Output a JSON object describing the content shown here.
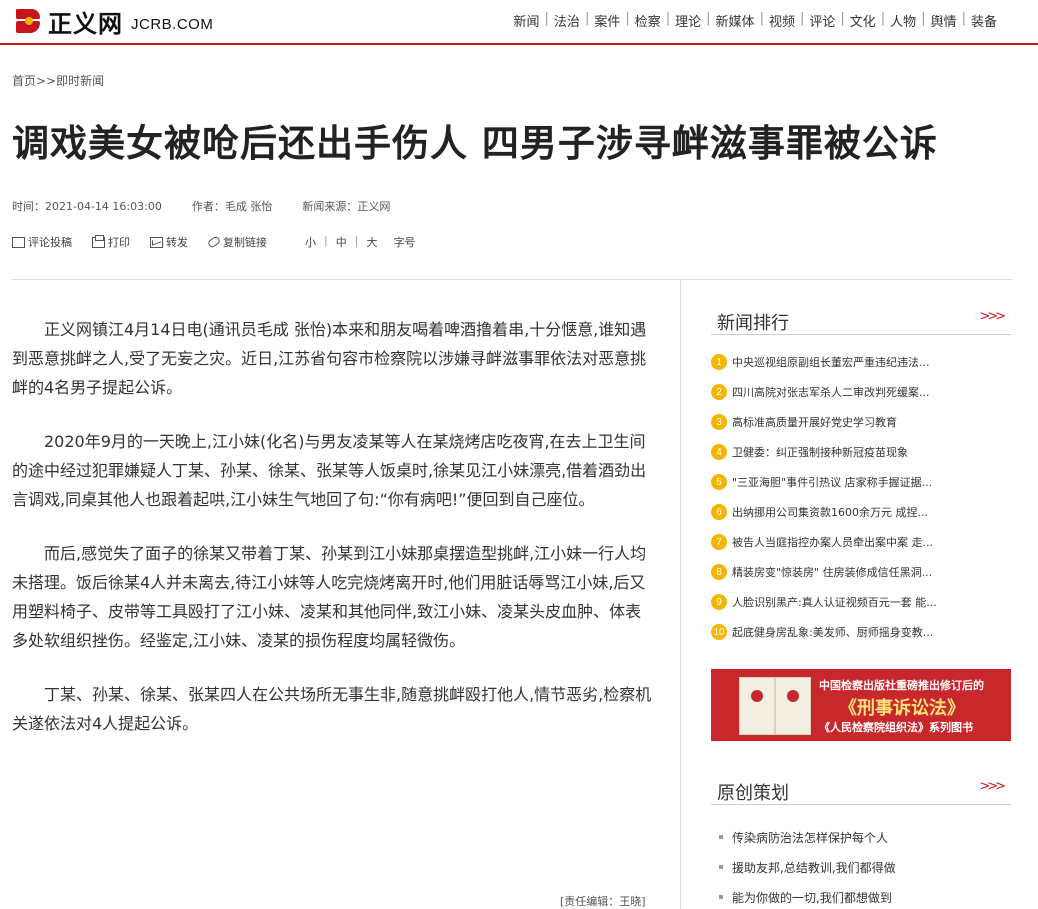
{
  "header": {
    "logo_text": "正义网",
    "logo_domain": "JCRB.COM",
    "nav": [
      "新闻",
      "法治",
      "案件",
      "检察",
      "理论",
      "新媒体",
      "视频",
      "评论",
      "文化",
      "人物",
      "舆情",
      "装备"
    ]
  },
  "breadcrumb": "首页>>即时新闻",
  "article": {
    "title": "调戏美女被呛后还出手伤人 四男子涉寻衅滋事罪被公诉",
    "time": "时间：2021-04-14 16:03:00",
    "author": "作者：毛成 张怡",
    "source": "新闻来源：正义网",
    "tools": {
      "comment": "评论投稿",
      "print": "打印",
      "forward": "转发",
      "copy_link": "复制链接",
      "size_small": "小",
      "size_medium": "中",
      "size_large": "大",
      "size_label": "字号"
    },
    "paragraphs": [
      "正义网镇江4月14日电(通讯员毛成 张怡)本来和朋友喝着啤酒撸着串,十分惬意,谁知遇到恶意挑衅之人,受了无妄之灾。近日,江苏省句容市检察院以涉嫌寻衅滋事罪依法对恶意挑衅的4名男子提起公诉。",
      "2020年9月的一天晚上,江小妹(化名)与男友凌某等人在某烧烤店吃夜宵,在去上卫生间的途中经过犯罪嫌疑人丁某、孙某、徐某、张某等人饭桌时,徐某见江小妹漂亮,借着酒劲出言调戏,同桌其他人也跟着起哄,江小妹生气地回了句:“你有病吧!”便回到自己座位。",
      "而后,感觉失了面子的徐某又带着丁某、孙某到江小妹那桌摆造型挑衅,江小妹一行人均未搭理。饭后徐某4人并未离去,待江小妹等人吃完烧烤离开时,他们用脏话辱骂江小妹,后又用塑料椅子、皮带等工具殴打了江小妹、凌某和其他同伴,致江小妹、凌某头皮血肿、体表多处软组织挫伤。经鉴定,江小妹、凌某的损伤程度均属轻微伤。",
      "丁某、孙某、徐某、张某四人在公共场所无事生非,随意挑衅殴打他人,情节恶劣,检察机关遂依法对4人提起公诉。"
    ],
    "editor": "[责任编辑：王晓]"
  },
  "sidebar": {
    "ranking_title": "新闻排行",
    "more": ">>>",
    "ranking": [
      {
        "num": "1",
        "text": "中央巡视组原副组长董宏严重违纪违法..."
      },
      {
        "num": "2",
        "text": "四川高院对张志军杀人二审改判死缓案..."
      },
      {
        "num": "3",
        "text": "高标准高质量开展好党史学习教育"
      },
      {
        "num": "4",
        "text": "卫健委：纠正强制接种新冠疫苗现象"
      },
      {
        "num": "5",
        "text": "\"三亚海胆\"事件引热议 店家称手握证据..."
      },
      {
        "num": "6",
        "text": "出纳挪用公司集资款1600余万元 成捏..."
      },
      {
        "num": "7",
        "text": "被告人当庭指控办案人员牵出案中案 走..."
      },
      {
        "num": "8",
        "text": "精装房变\"惊装房\" 住房装修成信任黑洞..."
      },
      {
        "num": "9",
        "text": "人脸识别黑产:真人认证视频百元一套 能..."
      },
      {
        "num": "10",
        "text": "起底健身房乱象:美发师、厨师摇身变教..."
      }
    ],
    "banner": {
      "line1": "中国检察出版社重磅推出修订后的",
      "line2": "《刑事诉讼法》",
      "line3": "《人民检察院组织法》系列图书"
    },
    "original_title": "原创策划",
    "original": [
      "传染病防治法怎样保护每个人",
      "援助友邦,总结教训,我们都得做",
      "能为你做的一切,我们都想做到"
    ]
  }
}
